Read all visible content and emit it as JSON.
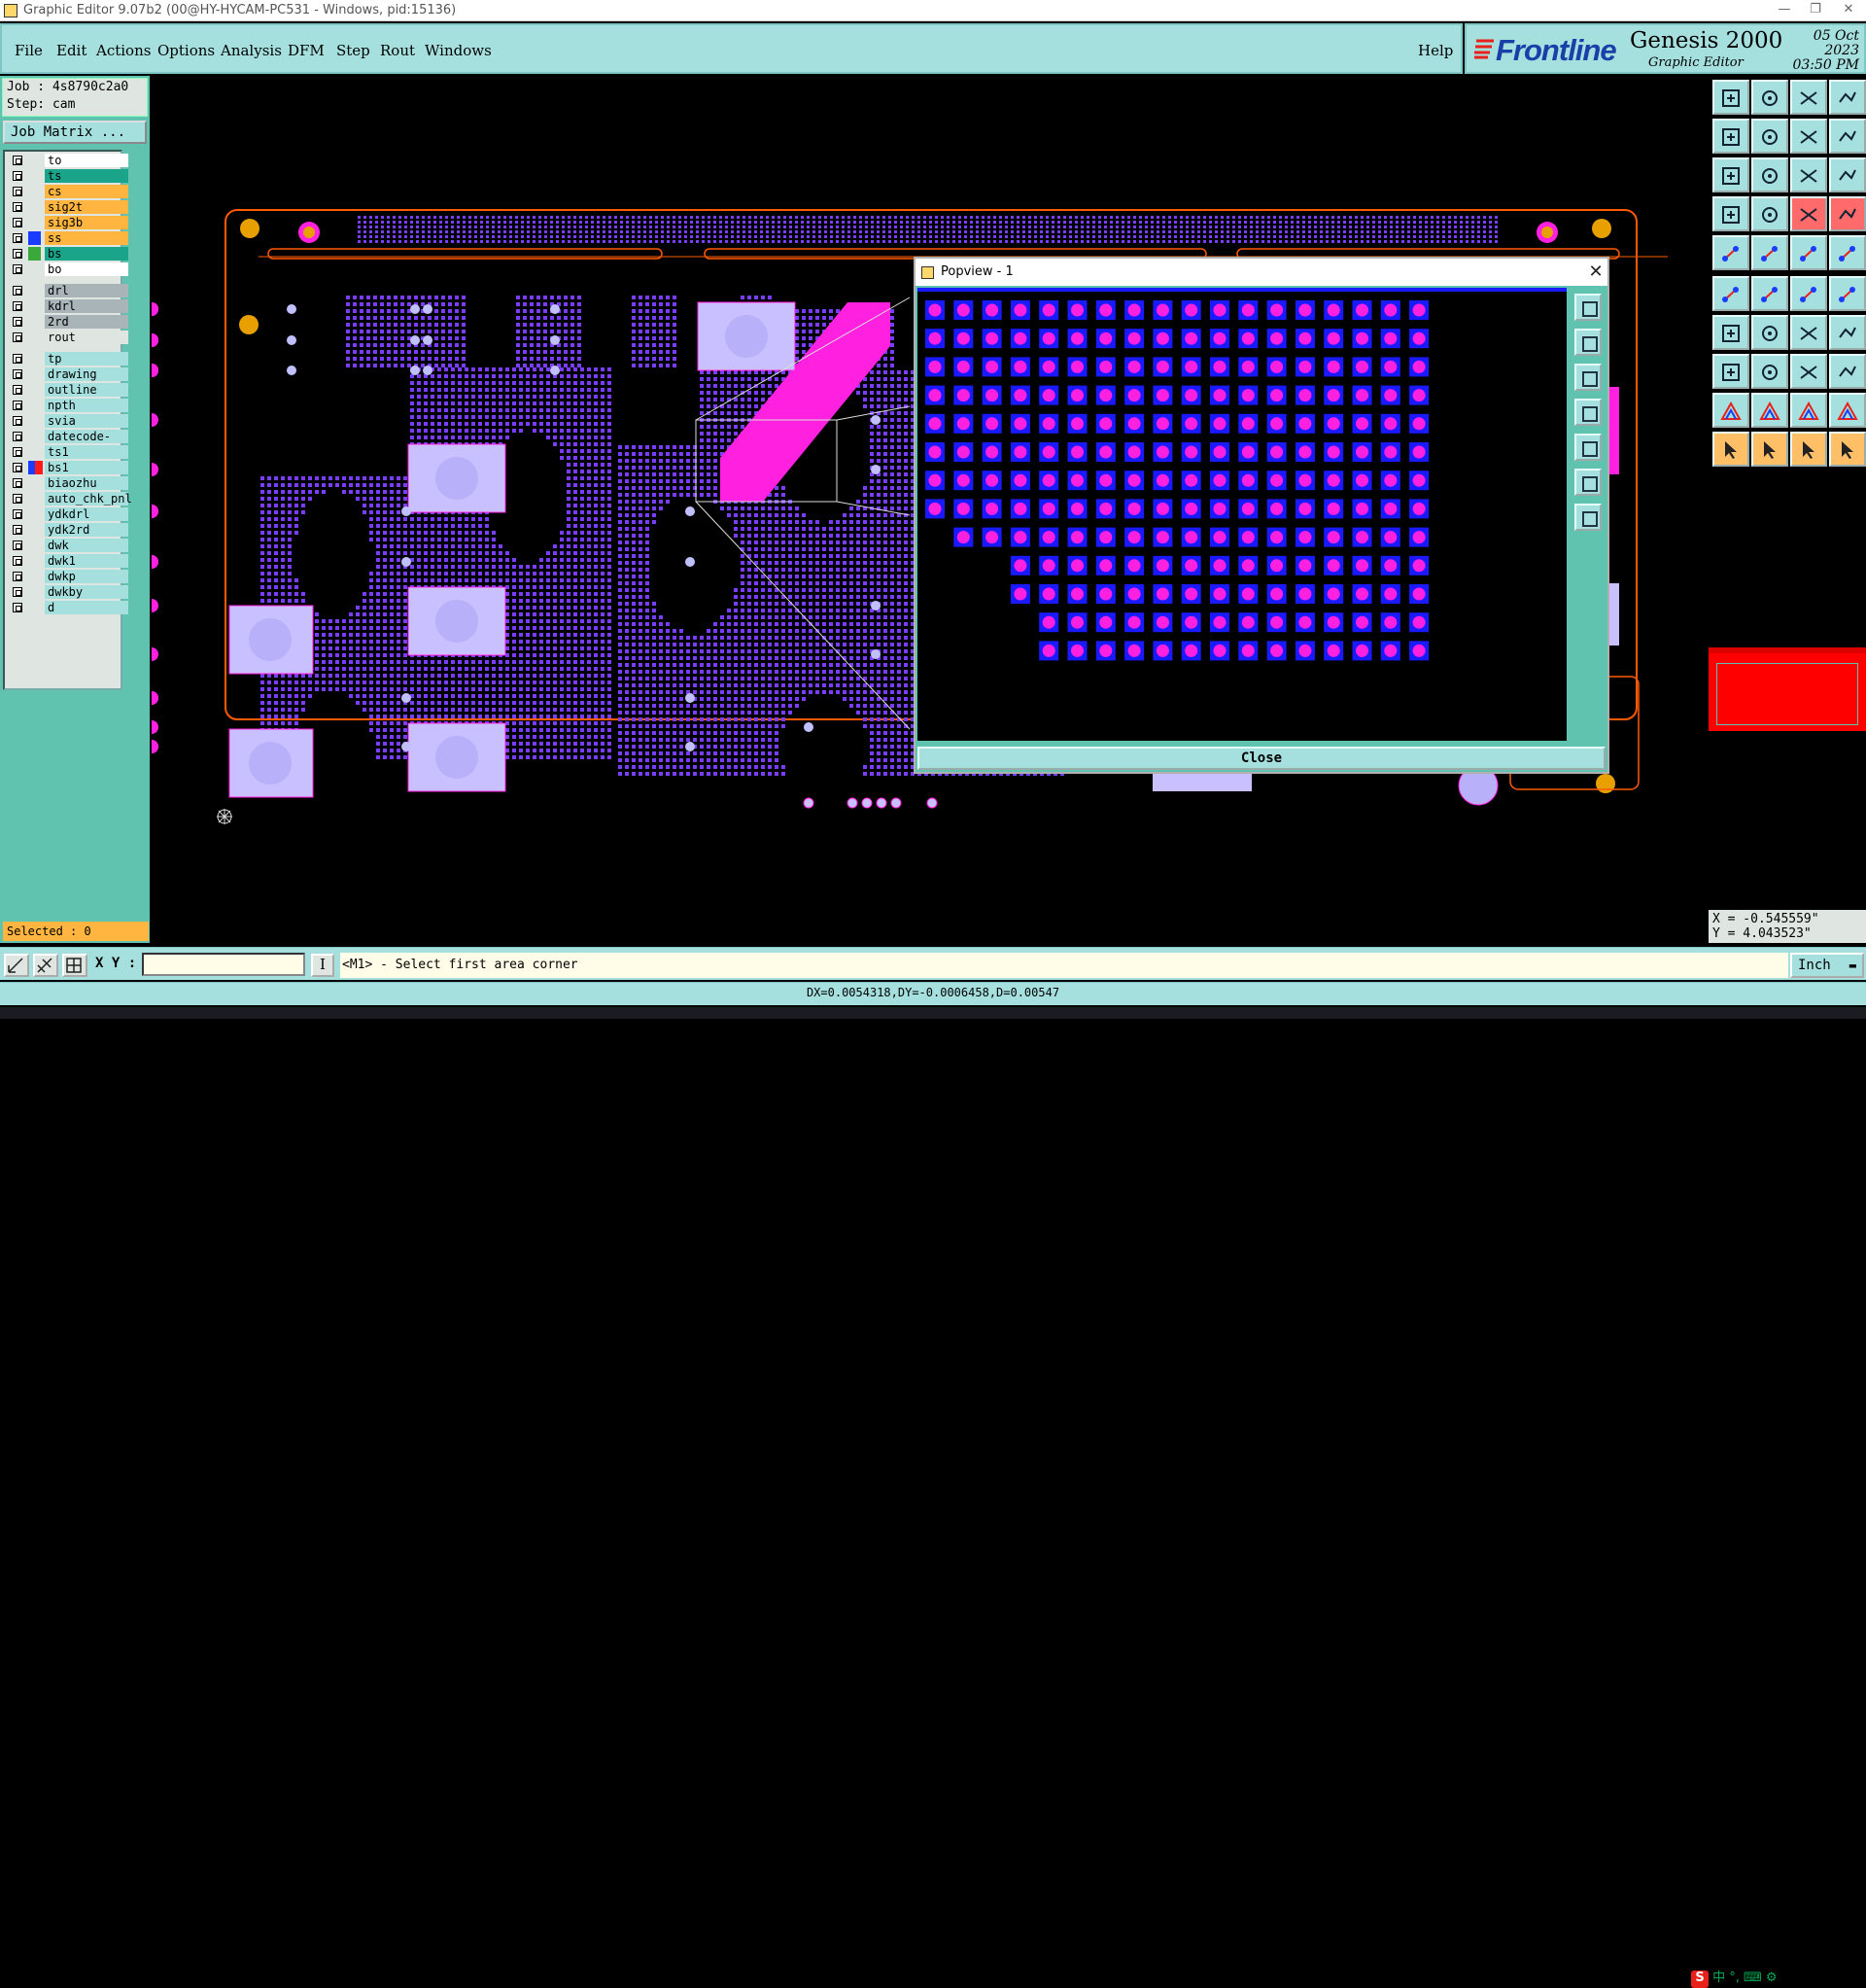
{
  "window": {
    "title": "Graphic Editor 9.07b2 (00@HY-HYCAM-PC531 - Windows, pid:15136)",
    "controls": [
      "—",
      "❐",
      "✕"
    ]
  },
  "menubar": {
    "items": [
      "File",
      "Edit",
      "Actions",
      "Options",
      "Analysis",
      "DFM",
      "Step",
      "Rout",
      "Windows"
    ],
    "help": "Help"
  },
  "brand": {
    "logo": "Frontline",
    "product": "Genesis 2000",
    "subtitle": "Graphic Editor",
    "date": "05 Oct 2023",
    "time": "03:50 PM"
  },
  "job": {
    "job_line": "Job : 4s8790c2a0",
    "step_line": "Step: cam",
    "matrix_button": "Job Matrix ..."
  },
  "layers": [
    {
      "name": "to",
      "color": "#ffffff",
      "swatch": "",
      "group": 0
    },
    {
      "name": "ts",
      "color": "#1aa58a",
      "swatch": "",
      "group": 0
    },
    {
      "name": "cs",
      "color": "#ffb53f",
      "swatch": "",
      "group": 0
    },
    {
      "name": "sig2t",
      "color": "#ffb53f",
      "swatch": "",
      "group": 0
    },
    {
      "name": "sig3b",
      "color": "#ffb53f",
      "swatch": "",
      "group": 0
    },
    {
      "name": "ss",
      "color": "#ffb53f",
      "swatch": "#1a3cff",
      "group": 0
    },
    {
      "name": "bs",
      "color": "#1aa58a",
      "swatch": "#3aa83a",
      "group": 0
    },
    {
      "name": "bo",
      "color": "#ffffff",
      "swatch": "",
      "group": 0
    },
    {
      "name": "drl",
      "color": "#a9b4b8",
      "swatch": "",
      "group": 1
    },
    {
      "name": "kdrl",
      "color": "#a9b4b8",
      "swatch": "",
      "group": 1
    },
    {
      "name": "2rd",
      "color": "#a9b4b8",
      "swatch": "",
      "group": 1
    },
    {
      "name": "rout",
      "color": "#dfe6e1",
      "swatch": "",
      "group": 1
    },
    {
      "name": "tp",
      "color": "#a5e0df",
      "swatch": "",
      "group": 2
    },
    {
      "name": "drawing",
      "color": "#a5e0df",
      "swatch": "",
      "group": 2
    },
    {
      "name": "outline",
      "color": "#a5e0df",
      "swatch": "",
      "group": 2
    },
    {
      "name": "npth",
      "color": "#a5e0df",
      "swatch": "",
      "group": 2
    },
    {
      "name": "svia",
      "color": "#a5e0df",
      "swatch": "",
      "group": 2
    },
    {
      "name": "datecode-pts",
      "color": "#a5e0df",
      "swatch": "",
      "group": 2
    },
    {
      "name": "ts1",
      "color": "#a5e0df",
      "swatch": "",
      "group": 2
    },
    {
      "name": "bs1",
      "color": "#a5e0df",
      "swatch": "#1a3cff",
      "swatch2": "#ff1a1a",
      "group": 2
    },
    {
      "name": "biaozhu",
      "color": "#a5e0df",
      "swatch": "",
      "group": 2
    },
    {
      "name": "auto_chk_pnl",
      "color": "#a5e0df",
      "swatch": "",
      "group": 2
    },
    {
      "name": "ydkdrl",
      "color": "#a5e0df",
      "swatch": "",
      "group": 2
    },
    {
      "name": "ydk2rd",
      "color": "#a5e0df",
      "swatch": "",
      "group": 2
    },
    {
      "name": "dwk",
      "color": "#a5e0df",
      "swatch": "",
      "group": 2
    },
    {
      "name": "dwk1",
      "color": "#a5e0df",
      "swatch": "",
      "group": 2
    },
    {
      "name": "dwkp",
      "color": "#a5e0df",
      "swatch": "",
      "group": 2
    },
    {
      "name": "dwkby",
      "color": "#a5e0df",
      "swatch": "",
      "group": 2
    },
    {
      "name": "d",
      "color": "#a5e0df",
      "swatch": "",
      "group": 2
    }
  ],
  "selected": "Selected : 0",
  "popview": {
    "title": "Popview - 1",
    "close_button": "Close"
  },
  "coords": {
    "x": "X = -0.545559\"",
    "y": "Y = 4.043523\""
  },
  "bottombar": {
    "xy_label": "X Y :",
    "xy_value": "",
    "prompt_button": "I",
    "prompt": "<M1> - Select first area corner",
    "units": "Inch"
  },
  "status": {
    "measure": "DX=0.0054318,DY=-0.0006458,D=0.00547"
  },
  "tray": "中 °, ⌨ ⚙",
  "colors": {
    "panel": "#a5e0df",
    "panel_dark": "#5fc3b0",
    "board_outline": "#ff5a00",
    "pad_purple": "#7a3cff",
    "pad_pink": "#ff20e0",
    "pad_light": "#c8c0ff",
    "fiducial": "#e8a000"
  }
}
